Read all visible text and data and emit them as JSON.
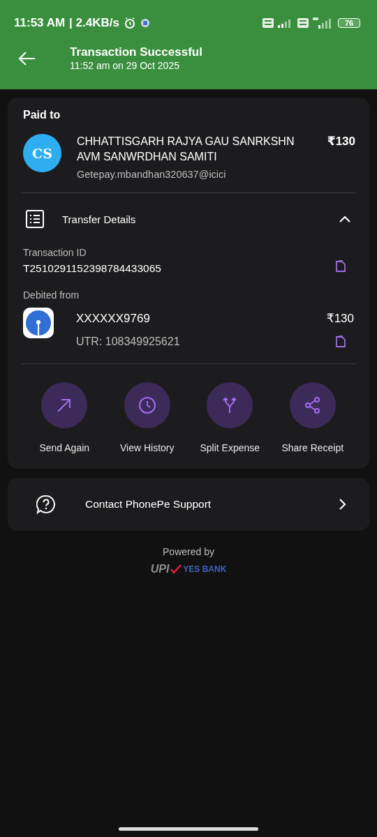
{
  "status_bar": {
    "time": "11:53 AM",
    "speed": "| 2.4KB/s",
    "battery": "76"
  },
  "header": {
    "title": "Transaction Successful",
    "subtitle": "11:52 am on 29 Oct 2025"
  },
  "payee": {
    "section_label": "Paid to",
    "initials": "CS",
    "name": "CHHATTISGARH RAJYA GAU SANRKSHN AVM SANWRDHAN SAMITI",
    "upi_id": "Getepay.mbandhan320637@icici",
    "amount": "₹130"
  },
  "transfer_details": {
    "title": "Transfer Details",
    "expanded": true,
    "transaction_id_label": "Transaction ID",
    "transaction_id": "T2510291152398784433065",
    "debited_label": "Debited from",
    "account": "XXXXXX9769",
    "amount": "₹130",
    "utr": "UTR: 108349925621"
  },
  "actions": [
    {
      "kind": "send",
      "label": "Send Again"
    },
    {
      "kind": "history",
      "label": "View History"
    },
    {
      "kind": "split",
      "label": "Split Expense"
    },
    {
      "kind": "share",
      "label": "Share Receipt"
    }
  ],
  "support": {
    "label": "Contact PhonePe Support"
  },
  "footer": {
    "powered_by": "Powered by",
    "upi": "UPI",
    "bank": "YES BANK"
  }
}
